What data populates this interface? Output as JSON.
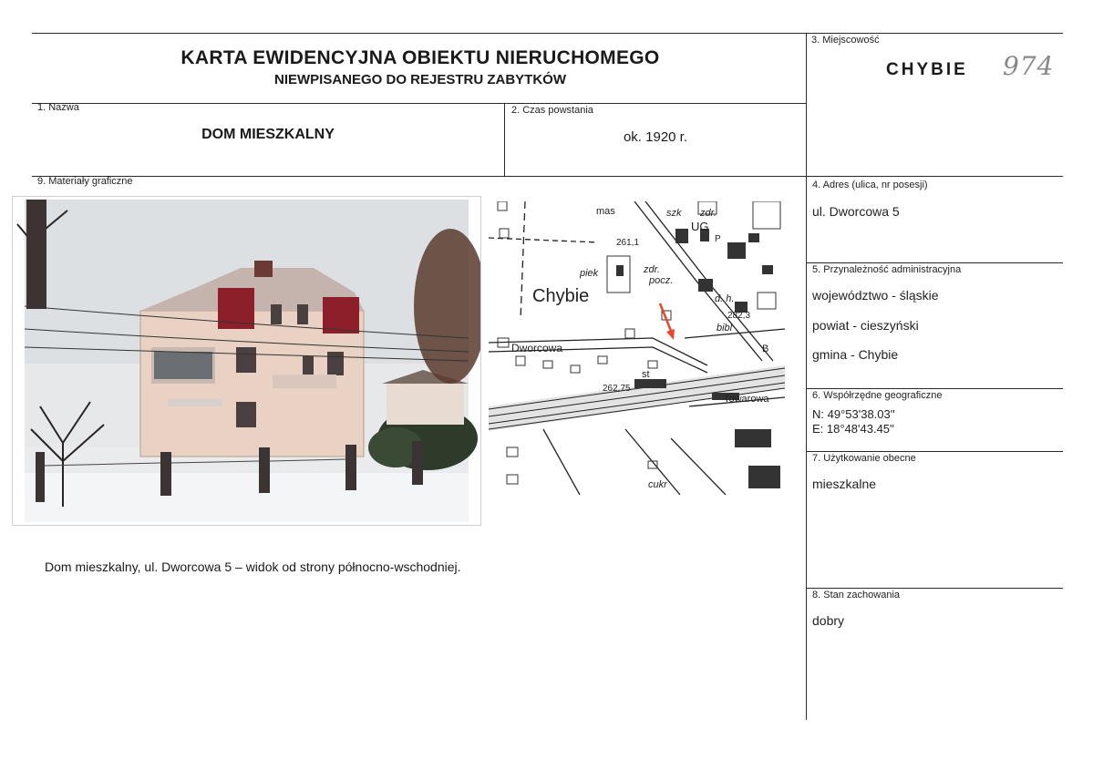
{
  "header": {
    "title": "KARTA EWIDENCYJNA OBIEKTU NIERUCHOMEGO",
    "subtitle": "NIEWPISANEGO DO REJESTRU ZABYTKÓW"
  },
  "fields": {
    "nazwa": {
      "label": "1. Nazwa",
      "value": "DOM MIESZKALNY"
    },
    "czas": {
      "label": "2. Czas powstania",
      "value": "ok. 1920 r."
    },
    "miejscowosc": {
      "label": "3. Miejscowość",
      "value": "CHYBIE",
      "handwritten": "974"
    },
    "adres": {
      "label": "4. Adres (ulica, nr posesji)",
      "value": "ul. Dworcowa 5"
    },
    "przynaleznosc": {
      "label": "5. Przynależność administracyjna",
      "wojewodztwo": "województwo - śląskie",
      "powiat": "powiat - cieszyński",
      "gmina": "gmina - Chybie"
    },
    "wspolrzedne": {
      "label": "6. Współrzędne geograficzne",
      "n": "N: 49°53'38.03''",
      "e": "E: 18°48'43.45''"
    },
    "uzytkowanie": {
      "label": "7. Użytkowanie obecne",
      "value": "mieszkalne"
    },
    "stan": {
      "label": "8. Stan zachowania",
      "value": "dobry"
    },
    "materialy": {
      "label": "9. Materiały graficzne"
    }
  },
  "caption": "Dom mieszkalny, ul. Dworcowa 5 – widok od strony północno-wschodniej.",
  "map": {
    "labels": {
      "mas": "mas",
      "szk": "szk",
      "zdr1": "zdr.",
      "ug": "UG",
      "p": "P",
      "h2611": "261,1",
      "piek": "piek",
      "zdr2": "zdr.",
      "pocz": "pocz.",
      "chybie": "Chybie",
      "dh": "d. h.",
      "h2823": "282,3",
      "bibl": "bibl",
      "dworcowa": "Dworcowa",
      "b": "B",
      "st": "st",
      "h26275": "262,75",
      "towarowa": "Towarowa",
      "cukr": "cukr"
    },
    "marker_color": "#e8472b"
  }
}
